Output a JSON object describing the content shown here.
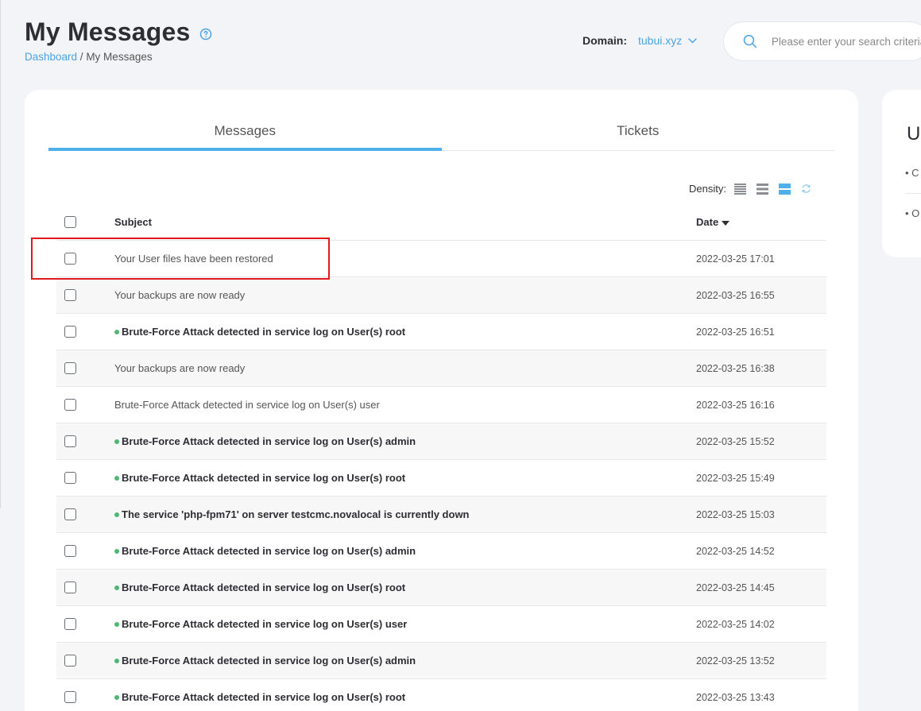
{
  "header": {
    "title": "My Messages",
    "breadcrumb": {
      "link": "Dashboard",
      "separator": " / ",
      "current": "My Messages"
    },
    "domain_label": "Domain:",
    "domain_value": "tubui.xyz",
    "search_placeholder": "Please enter your search criteria"
  },
  "tabs": [
    {
      "label": "Messages",
      "active": true
    },
    {
      "label": "Tickets",
      "active": false
    }
  ],
  "density": {
    "label": "Density:",
    "options": [
      "compact",
      "normal",
      "comfortable"
    ],
    "selected": "comfortable"
  },
  "table": {
    "columns": {
      "subject": "Subject",
      "date": "Date"
    },
    "rows": [
      {
        "subject": "Your User files have been restored",
        "date": "2022-03-25 17:01",
        "unread": false
      },
      {
        "subject": "Your backups are now ready",
        "date": "2022-03-25 16:55",
        "unread": false
      },
      {
        "subject": "Brute-Force Attack detected in service log on User(s) root",
        "date": "2022-03-25 16:51",
        "unread": true
      },
      {
        "subject": "Your backups are now ready",
        "date": "2022-03-25 16:38",
        "unread": false
      },
      {
        "subject": "Brute-Force Attack detected in service log on User(s) user",
        "date": "2022-03-25 16:16",
        "unread": false
      },
      {
        "subject": "Brute-Force Attack detected in service log on User(s) admin",
        "date": "2022-03-25 15:52",
        "unread": true
      },
      {
        "subject": "Brute-Force Attack detected in service log on User(s) root",
        "date": "2022-03-25 15:49",
        "unread": true
      },
      {
        "subject": "The service 'php-fpm71' on server testcmc.novalocal is currently down",
        "date": "2022-03-25 15:03",
        "unread": true
      },
      {
        "subject": "Brute-Force Attack detected in service log on User(s) admin",
        "date": "2022-03-25 14:52",
        "unread": true
      },
      {
        "subject": "Brute-Force Attack detected in service log on User(s) root",
        "date": "2022-03-25 14:45",
        "unread": true
      },
      {
        "subject": "Brute-Force Attack detected in service log on User(s) user",
        "date": "2022-03-25 14:02",
        "unread": true
      },
      {
        "subject": "Brute-Force Attack detected in service log on User(s) admin",
        "date": "2022-03-25 13:52",
        "unread": true
      },
      {
        "subject": "Brute-Force Attack detected in service log on User(s) root",
        "date": "2022-03-25 13:43",
        "unread": true
      }
    ]
  },
  "side_panel": {
    "heading": "U",
    "items": [
      "• C",
      "• O"
    ]
  },
  "colors": {
    "accent": "#4fb0ea",
    "link": "#4aa3e6",
    "unread_dot": "#4cb873",
    "highlight": "#e0191f"
  }
}
